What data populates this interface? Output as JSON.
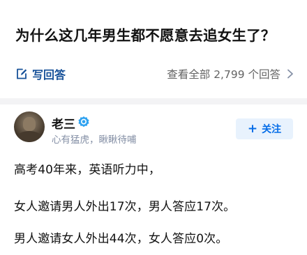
{
  "question": {
    "title": "为什么这几年男生都不愿意去追女生了？"
  },
  "answer_bar": {
    "write_answer_label": "写回答",
    "view_all_label": "查看全部 2,799 个回答",
    "view_all_icon": "chevron-right-icon",
    "write_icon": "edit-icon"
  },
  "author": {
    "name": "老三",
    "headline": "心有猛虎，瞅瞅待哺",
    "verify_icon": "verified-badge-icon"
  },
  "follow": {
    "plus": "+",
    "label": "关注"
  },
  "answer": {
    "paragraphs": [
      "高考40年来，英语听力中，",
      "女人邀请男人外出17次，男人答应17次。",
      "男人邀请女人外出44次，女人答应0次。"
    ]
  },
  "colors": {
    "link_blue": "#175199",
    "follow_blue": "#056de8",
    "muted_gray": "#8590a6",
    "divider": "#f3f3f5"
  }
}
